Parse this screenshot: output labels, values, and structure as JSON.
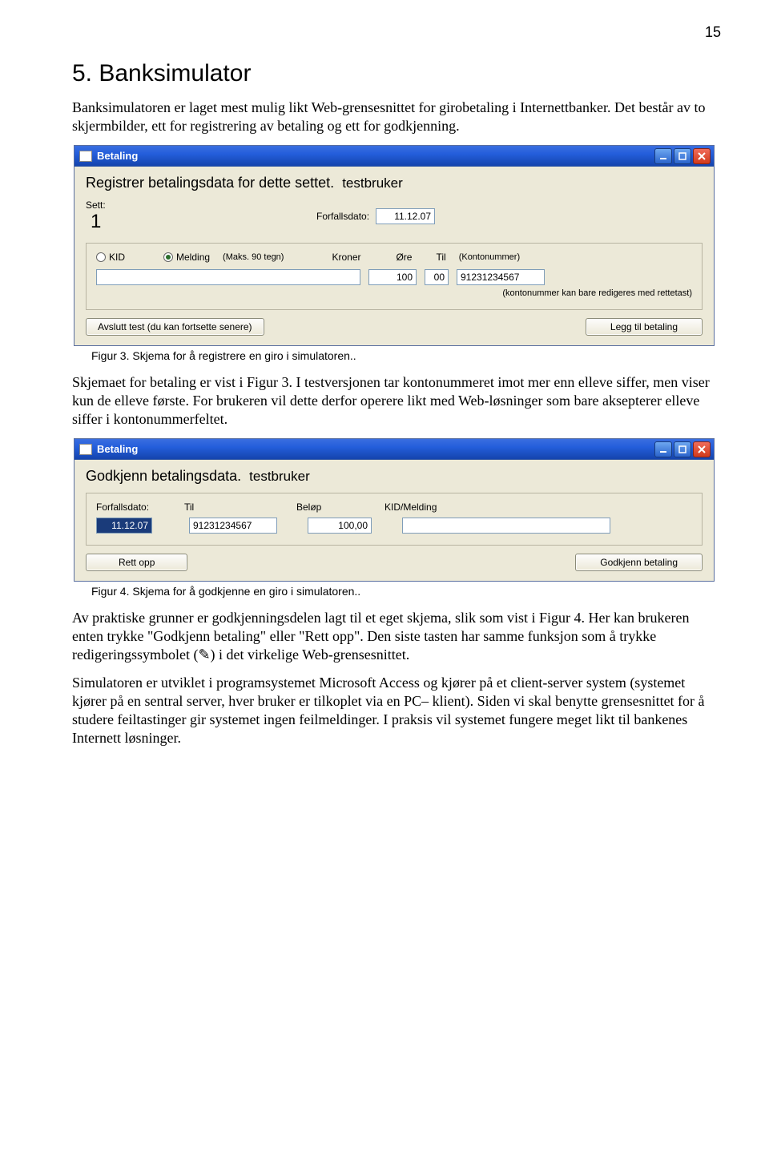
{
  "page_number": "15",
  "heading": "5.   Banksimulator",
  "p1": "Banksimulatoren er laget mest mulig likt Web-grensesnittet for girobetaling i Internettbanker. Det består av to skjermbilder, ett for registrering av betaling og ett for godkjenning.",
  "caption1": "Figur 3. Skjema for å registrere en giro i simulatoren..",
  "p2": "Skjemaet for betaling er vist i Figur 3. I testversjonen tar kontonummeret imot mer enn elleve siffer, men viser kun de elleve første. For brukeren vil dette derfor operere likt med Web-løsninger som bare aksepterer elleve siffer i kontonummerfeltet.",
  "caption2": "Figur 4. Skjema for å godkjenne en giro i simulatoren..",
  "p3": "Av praktiske grunner er godkjenningsdelen lagt til et eget skjema, slik som vist i Figur 4. Her kan brukeren enten trykke \"Godkjenn betaling\" eller \"Rett opp\". Den siste tasten har samme funksjon som å trykke redigeringssymbolet (✎) i det virkelige Web-grensesnittet.",
  "p4": "Simulatoren er utviklet i programsystemet Microsoft Access og kjører på et client-server system (systemet kjører på en sentral server, hver bruker er tilkoplet via en PC– klient). Siden vi skal benytte grensesnittet for å studere feiltastinger gir systemet ingen feilmeldinger. I praksis vil systemet fungere meget likt til bankenes Internett løsninger.",
  "win1": {
    "title": "Betaling",
    "heading": "Registrer betalingsdata for dette settet.",
    "user": "testbruker",
    "sett_label": "Sett:",
    "sett_value": "1",
    "forfall_label": "Forfallsdato:",
    "forfall_value": "11.12.07",
    "kid_label": "KID",
    "melding_label": "Melding",
    "maks_note": "(Maks. 90 tegn)",
    "kroner_label": "Kroner",
    "ore_label": "Øre",
    "til_label": "Til",
    "konto_note": "(Kontonummer)",
    "kroner_value": "100",
    "ore_value": "00",
    "konto_value": "91231234567",
    "konto_edit_note": "(kontonummer kan bare redigeres med rettetast)",
    "btn_avslutt": "Avslutt test (du kan fortsette senere)",
    "btn_legg": "Legg til betaling"
  },
  "win2": {
    "title": "Betaling",
    "heading": "Godkjenn betalingsdata.",
    "user": "testbruker",
    "forfall_label": "Forfallsdato:",
    "til_label": "Til",
    "belop_label": "Beløp",
    "kidmelding_label": "KID/Melding",
    "forfall_value": "11.12.07",
    "til_value": "91231234567",
    "belop_value": "100,00",
    "btn_rett": "Rett opp",
    "btn_godkjenn": "Godkjenn betaling"
  }
}
